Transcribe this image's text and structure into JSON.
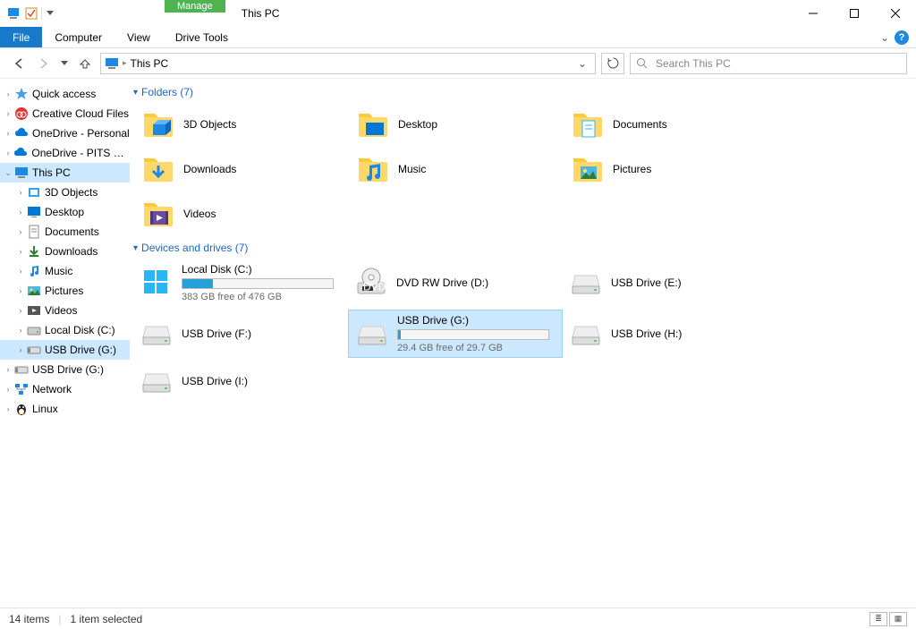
{
  "window": {
    "title": "This PC",
    "context_label": "Manage",
    "context_subtab": "Drive Tools"
  },
  "ribbon": {
    "file": "File",
    "tabs": [
      "Computer",
      "View"
    ]
  },
  "nav": {
    "address": "This PC",
    "search_placeholder": "Search This PC"
  },
  "tree": {
    "items": [
      {
        "label": "Quick access",
        "icon": "star",
        "indent": 0
      },
      {
        "label": "Creative Cloud Files",
        "icon": "cc",
        "indent": 0
      },
      {
        "label": "OneDrive - Personal",
        "icon": "cloud",
        "indent": 0
      },
      {
        "label": "OneDrive - PITS Glob",
        "icon": "cloud",
        "indent": 0
      },
      {
        "label": "This PC",
        "icon": "pc",
        "indent": 0,
        "selected": true,
        "expanded": true
      },
      {
        "label": "3D Objects",
        "icon": "3d",
        "indent": 1
      },
      {
        "label": "Desktop",
        "icon": "desktop",
        "indent": 1
      },
      {
        "label": "Documents",
        "icon": "docs",
        "indent": 1
      },
      {
        "label": "Downloads",
        "icon": "dl",
        "indent": 1
      },
      {
        "label": "Music",
        "icon": "music",
        "indent": 1
      },
      {
        "label": "Pictures",
        "icon": "pics",
        "indent": 1
      },
      {
        "label": "Videos",
        "icon": "video",
        "indent": 1
      },
      {
        "label": "Local Disk (C:)",
        "icon": "disk",
        "indent": 1
      },
      {
        "label": "USB Drive (G:)",
        "icon": "usb",
        "indent": 1,
        "selected": true
      },
      {
        "label": "USB Drive (G:)",
        "icon": "usb",
        "indent": 0
      },
      {
        "label": "Network",
        "icon": "net",
        "indent": 0
      },
      {
        "label": "Linux",
        "icon": "linux",
        "indent": 0
      }
    ]
  },
  "groups": {
    "folders": {
      "header": "Folders (7)"
    },
    "drives": {
      "header": "Devices and drives (7)"
    }
  },
  "folders": [
    {
      "label": "3D Objects"
    },
    {
      "label": "Desktop"
    },
    {
      "label": "Documents"
    },
    {
      "label": "Downloads"
    },
    {
      "label": "Music"
    },
    {
      "label": "Pictures"
    },
    {
      "label": "Videos"
    }
  ],
  "drives": [
    {
      "label": "Local Disk (C:)",
      "free": "383 GB free of 476 GB",
      "fill_pct": 20,
      "icon": "win"
    },
    {
      "label": "DVD RW Drive (D:)",
      "icon": "dvd"
    },
    {
      "label": "USB Drive (E:)",
      "icon": "drive"
    },
    {
      "label": "USB Drive (F:)",
      "icon": "drive"
    },
    {
      "label": "USB Drive (G:)",
      "free": "29.4 GB free of 29.7 GB",
      "fill_pct": 2,
      "icon": "drive",
      "selected": true
    },
    {
      "label": "USB Drive (H:)",
      "icon": "drive"
    },
    {
      "label": "USB Drive (I:)",
      "icon": "drive"
    }
  ],
  "status": {
    "items": "14 items",
    "selected": "1 item selected"
  }
}
